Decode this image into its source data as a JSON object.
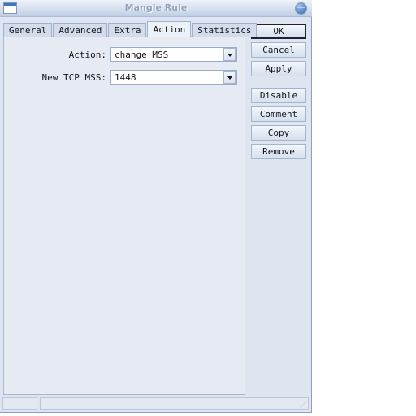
{
  "window": {
    "title": "Mangle Rule",
    "icon": "window-icon",
    "close_icon": "close-circle-icon"
  },
  "tabs": [
    {
      "label": "General",
      "active": false
    },
    {
      "label": "Advanced",
      "active": false
    },
    {
      "label": "Extra",
      "active": false
    },
    {
      "label": "Action",
      "active": true
    },
    {
      "label": "Statistics",
      "active": false
    }
  ],
  "form": {
    "fields": [
      {
        "label": "Action:",
        "value": "change MSS"
      },
      {
        "label": "New TCP MSS:",
        "value": "1448"
      }
    ]
  },
  "buttons": [
    {
      "label": "OK",
      "default": true
    },
    {
      "label": "Cancel",
      "default": false
    },
    {
      "label": "Apply",
      "default": false
    },
    {
      "label": "Disable",
      "default": false
    },
    {
      "label": "Comment",
      "default": false
    },
    {
      "label": "Copy",
      "default": false
    },
    {
      "label": "Remove",
      "default": false
    }
  ],
  "statusbar": {
    "left_text": "",
    "right_text": ""
  },
  "colors": {
    "window_bg": "#dfe5f0",
    "panel_bg": "#e6eaf2",
    "titlebar_text": "#8fa3bd",
    "accent_blue": "#3d76c4",
    "border": "#a2b4ce"
  }
}
